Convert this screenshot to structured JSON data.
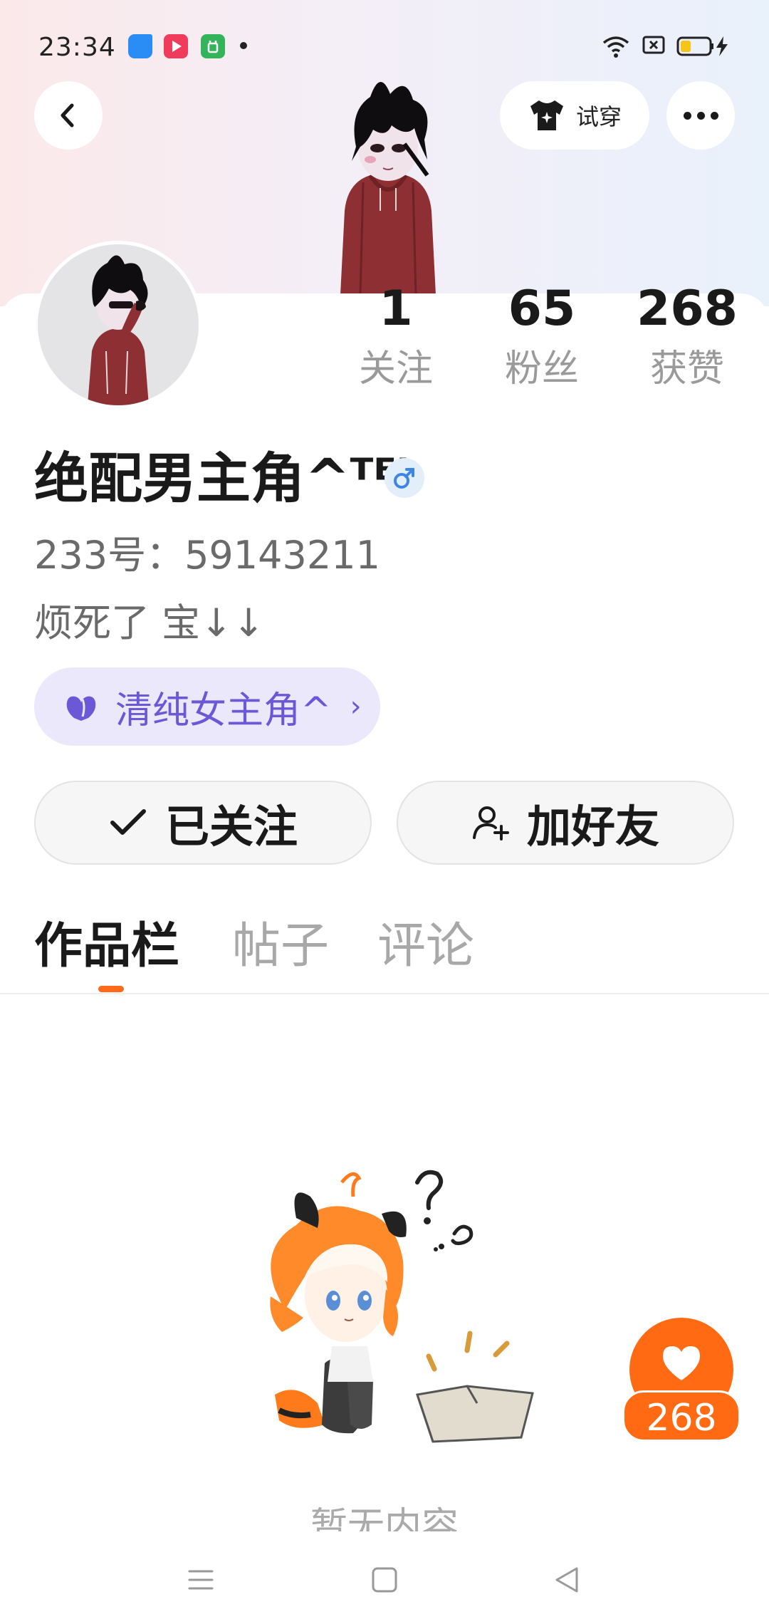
{
  "status_bar": {
    "time": "23:34",
    "app_icons": [
      {
        "name": "blue-app-icon",
        "color": "#2a8cf5"
      },
      {
        "name": "video-app-icon",
        "color": "#ef3b5c"
      },
      {
        "name": "green-app-icon",
        "color": "#34b45a"
      }
    ]
  },
  "header": {
    "try_label": "试穿"
  },
  "stats": [
    {
      "value": "1",
      "label": "关注"
    },
    {
      "value": "65",
      "label": "粉丝"
    },
    {
      "value": "268",
      "label": "获赞"
    }
  ],
  "profile": {
    "nickname": "绝配男主角^ᵀᴱᴸ",
    "uid": "233号：59143211",
    "bio": "烦死了 宝↓↓",
    "tag": "清纯女主角^"
  },
  "actions": {
    "followed_label": "已关注",
    "add_friend_label": "加好友"
  },
  "tabs": [
    {
      "label": "作品栏",
      "active": true
    },
    {
      "label": "帖子",
      "active": false
    },
    {
      "label": "评论",
      "active": false
    }
  ],
  "empty_state": {
    "text": "暂无内容"
  },
  "floating_like": {
    "count": "268"
  },
  "colors": {
    "accent": "#ff6a13",
    "tag_text": "#6a58d6",
    "tag_bg": "#ece8fb",
    "hood_red": "#8e2f33"
  }
}
